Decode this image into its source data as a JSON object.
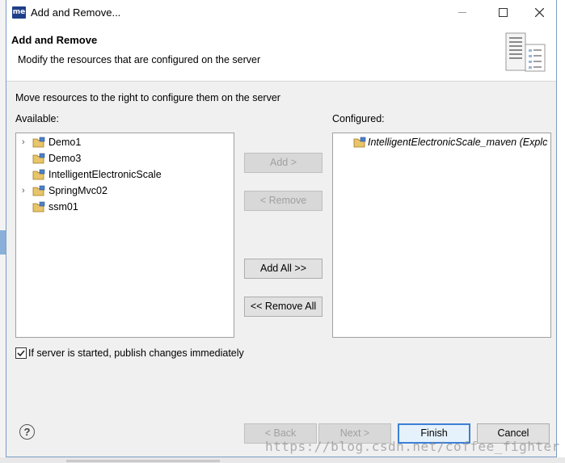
{
  "window": {
    "app_icon_text": "me",
    "title": "Add and Remove..."
  },
  "banner": {
    "title": "Add and Remove",
    "description": "Modify the resources that are configured on the server"
  },
  "instructions": "Move resources to the right to configure them on the server",
  "available": {
    "label": "Available:",
    "items": [
      {
        "label": "Demo1",
        "expandable": true
      },
      {
        "label": "Demo3",
        "expandable": false
      },
      {
        "label": "IntelligentElectronicScale",
        "expandable": false
      },
      {
        "label": "SpringMvc02",
        "expandable": true
      },
      {
        "label": "ssm01",
        "expandable": false
      }
    ]
  },
  "configured": {
    "label": "Configured:",
    "items": [
      {
        "label": "IntelligentElectronicScale_maven (Explc"
      }
    ]
  },
  "transfer_buttons": {
    "add": "Add >",
    "remove": "< Remove",
    "add_all": "Add All >>",
    "remove_all": "<< Remove All"
  },
  "publish_checkbox": {
    "label": "If server is started, publish changes immediately",
    "checked": true
  },
  "footer_buttons": {
    "back": "< Back",
    "next": "Next >",
    "finish": "Finish",
    "cancel": "Cancel"
  },
  "help_icon_glyph": "?",
  "watermark": "https://blog.csdn.net/coffee_fighter",
  "colors": {
    "accent": "#3c7fd6",
    "app_icon_bg": "#1e3f8a",
    "disabled_text": "#a0a0a0"
  }
}
